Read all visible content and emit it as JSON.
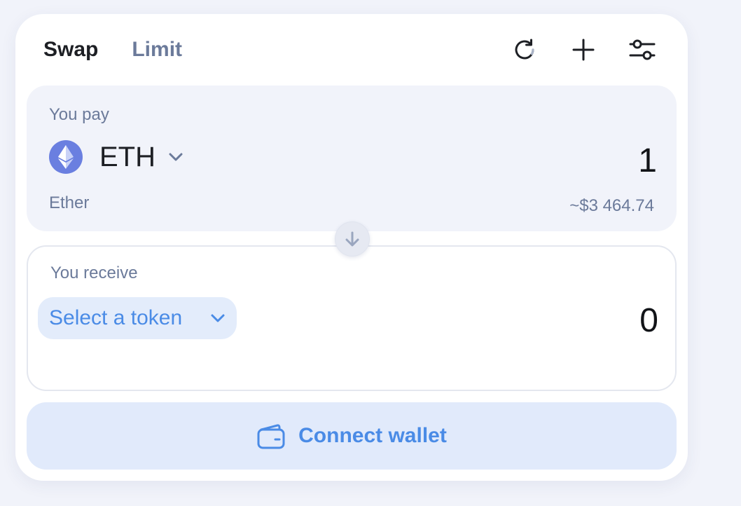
{
  "tabs": [
    {
      "label": "Swap",
      "active": true
    },
    {
      "label": "Limit",
      "active": false
    }
  ],
  "header_actions": [
    "refresh-icon",
    "plus-icon",
    "settings-sliders-icon"
  ],
  "pay": {
    "label": "You pay",
    "token_symbol": "ETH",
    "token_name": "Ether",
    "amount": "1",
    "fiat_value": "~$3 464.74",
    "token_icon": "ethereum-icon"
  },
  "switch_icon": "arrow-down-icon",
  "receive": {
    "label": "You receive",
    "select_label": "Select a token",
    "amount": "0"
  },
  "connect": {
    "label": "Connect wallet",
    "icon": "wallet-icon"
  },
  "colors": {
    "accent": "#4a8be6",
    "accent_bg": "#e1eafb",
    "muted_text": "#6b7a9a",
    "panel_bg": "#f1f3fa",
    "eth": "#6a7fe0"
  }
}
